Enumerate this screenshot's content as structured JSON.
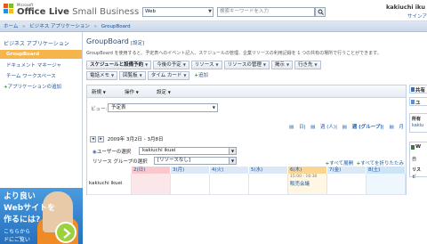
{
  "header": {
    "brand_small": "Microsoft",
    "brand_name": "Office Live",
    "brand_suffix": "Small Business",
    "search_scope": "Web",
    "search_placeholder": "検索キーワードを入力",
    "user_name": "kakiuchi iku",
    "sign_out": "サインア"
  },
  "breadcrumb": [
    "ホーム",
    "ビジネス アプリケーション",
    "GroupBoard"
  ],
  "leftnav": {
    "heading": "ビジネス アプリケーション",
    "items": [
      "GroupBoard",
      "ドキュメント マネージャ",
      "チーム ワークスペース"
    ],
    "add_label": "アプリケーションの追加"
  },
  "ad": {
    "line1": "より良い",
    "line2": "Webサイトを",
    "line2b": "作るには?",
    "line3": "こちらから",
    "line4": "ドにご覧い"
  },
  "main": {
    "title": "GroupBoard",
    "settings_link": "設定",
    "description": "GroupBoard を使用すると、予定表へのイベント記入、スケジュールの管理、企業リソースの利用記録を 1 つの共有の場所で行うことができます。",
    "menu_row1": [
      "スケジュールと設備予約",
      "今後の予定",
      "リソース",
      "リソースの管理",
      "掲示",
      "行き先"
    ],
    "menu_row2": [
      "電話メモ",
      "回覧板",
      "タイム カード"
    ],
    "add_link": "追加"
  },
  "panel": {
    "toolbar": [
      "新規",
      "操作",
      "設定"
    ],
    "view_label": "ビュー:",
    "view_value": "予定表",
    "view_links": [
      "日",
      "週 (人)",
      "週 (グループ)",
      "月"
    ],
    "date_range": "2009年 3月2日 - 3月8日",
    "user_select_label": "ユーザーの選択",
    "user_select_value": "kakiuchi ikuei",
    "resource_select_label": "リソース グループの選択",
    "resource_select_value": "[リソースなし]",
    "expand_all": "すべて展開",
    "collapse_all": "すべてを折りたたみ"
  },
  "calendar": {
    "days": [
      "2(日)",
      "3(月)",
      "4(火)",
      "5(水)",
      "6(木)",
      "7(金)",
      "8(土)"
    ],
    "row_user": "kakiuchi ikuei",
    "event_time": "15:00 - 16:30",
    "event_title": "販売会議"
  },
  "rightcol": {
    "box1_title": "共有",
    "box2_title": "ユ",
    "box3_label": "所有",
    "box3_link": "kakiu",
    "box4_title": "W",
    "box4_text": "自",
    "box5_text": "リス",
    "box5_sub": "ビ"
  },
  "colors": {
    "accent_orange": "#f6b54a",
    "link_blue": "#1f5ea8",
    "sunday_pink": "#f8c8cc",
    "today_orange": "#fbd692"
  }
}
